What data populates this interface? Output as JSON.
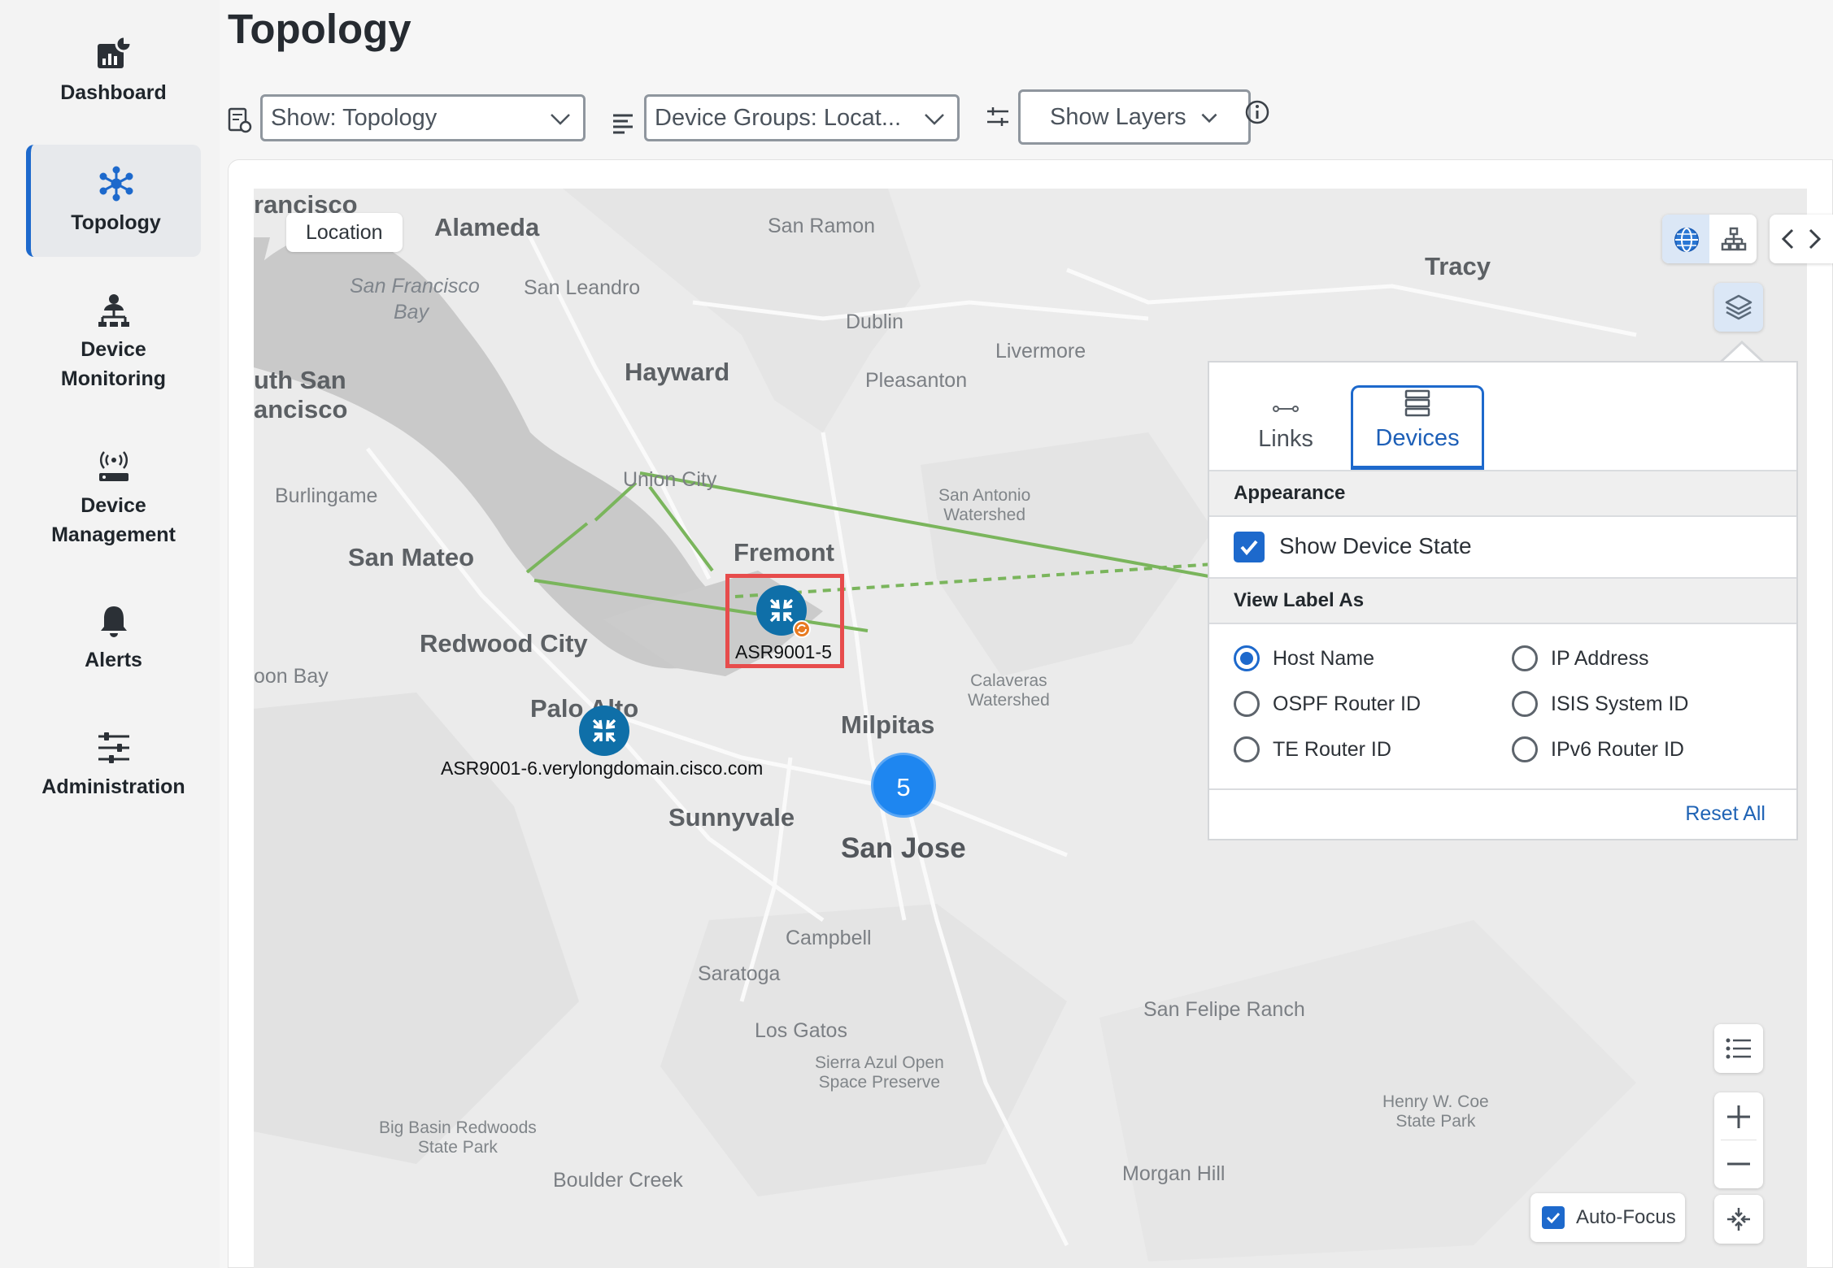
{
  "sidebar": {
    "items": [
      {
        "label": "Dashboard",
        "icon": "dashboard-icon"
      },
      {
        "label": "Topology",
        "icon": "topology-icon",
        "active": true
      },
      {
        "label_line1": "Device",
        "label_line2": "Monitoring",
        "icon": "device-monitoring-icon"
      },
      {
        "label_line1": "Device",
        "label_line2": "Management",
        "icon": "device-management-icon"
      },
      {
        "label": "Alerts",
        "icon": "bell-icon"
      },
      {
        "label": "Administration",
        "icon": "sliders-icon"
      }
    ]
  },
  "header": {
    "title": "Topology",
    "show_select": "Show: Topology",
    "device_groups_select": "Device Groups: Locat...",
    "show_layers": "Show Layers"
  },
  "map": {
    "location_chip": "Location",
    "places": {
      "francisco": "rancisco",
      "alameda": "Alameda",
      "san_ramon": "San Ramon",
      "tracy": "Tracy",
      "sf_bay_1": "San Francisco",
      "sf_bay_2": "Bay",
      "san_leandro": "San Leandro",
      "dublin": "Dublin",
      "livermore": "Livermore",
      "south_sf_1": "uth San",
      "south_sf_2": "ancisco",
      "hayward": "Hayward",
      "pleasanton": "Pleasanton",
      "union_city": "Union City",
      "burlingame": "Burlingame",
      "san_antonio_1": "San Antonio",
      "san_antonio_2": "Watershed",
      "san_mateo": "San Mateo",
      "fremont": "Fremont",
      "redwood_city": "Redwood City",
      "calaveras_1": "Calaveras",
      "calaveras_2": "Watershed",
      "moon_bay": "oon Bay",
      "palo_alto": "Palo Alto",
      "milpitas": "Milpitas",
      "sunnyvale": "Sunnyvale",
      "san_jose": "San Jose",
      "campbell": "Campbell",
      "saratoga": "Saratoga",
      "san_felipe": "San Felipe Ranch",
      "los_gatos": "Los Gatos",
      "sierra_1": "Sierra Azul Open",
      "sierra_2": "Space Preserve",
      "henry_1": "Henry W. Coe",
      "henry_2": "State Park",
      "big_basin_1": "Big Basin Redwoods",
      "big_basin_2": "State Park",
      "boulder_creek": "Boulder Creek",
      "morgan_hill": "Morgan Hill"
    },
    "devices": [
      {
        "label": "ASR9001-5",
        "icon": "router-icon"
      },
      {
        "label": "ASR9001-6.verylongdomain.cisco.com",
        "icon": "router-icon"
      }
    ],
    "cluster_count": "5",
    "autofocus_label": "Auto-Focus",
    "colors": {
      "link": "#7ab55c",
      "node": "#0f6fa8",
      "cluster": "#1e86f0",
      "highlight": "#e74c4c"
    }
  },
  "layers_panel": {
    "tabs": [
      {
        "label": "Links",
        "icon": "link-icon"
      },
      {
        "label": "Devices",
        "icon": "devices-icon",
        "active": true
      }
    ],
    "appearance_header": "Appearance",
    "show_device_state": "Show Device State",
    "view_label_header": "View Label As",
    "label_options": [
      {
        "label": "Host Name",
        "selected": true
      },
      {
        "label": "IP Address",
        "selected": false
      },
      {
        "label": "OSPF Router ID",
        "selected": false
      },
      {
        "label": "ISIS System ID",
        "selected": false
      },
      {
        "label": "TE Router ID",
        "selected": false
      },
      {
        "label": "IPv6 Router ID",
        "selected": false
      }
    ],
    "reset_all": "Reset All"
  }
}
